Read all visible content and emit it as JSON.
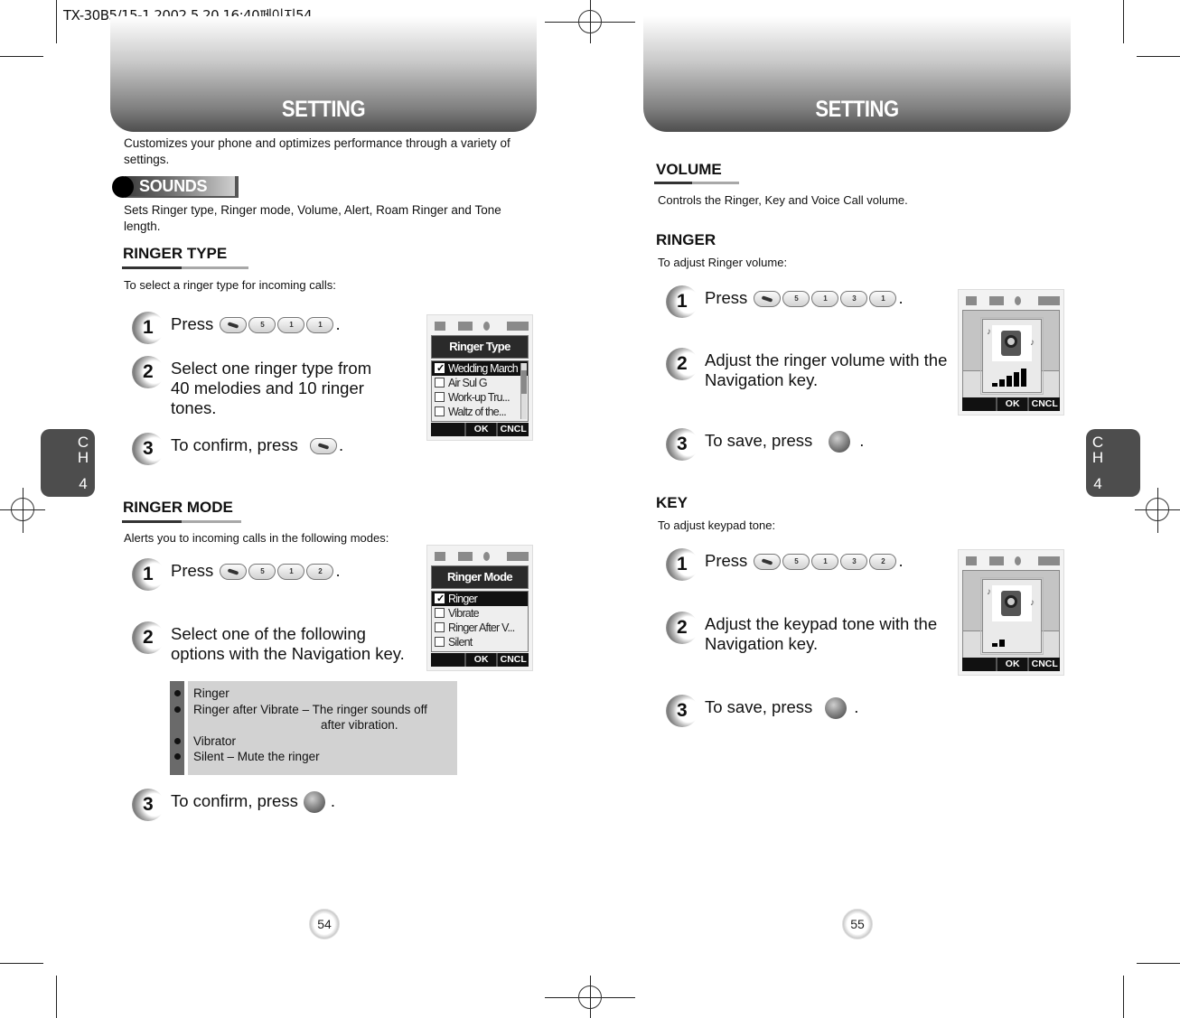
{
  "print_header": "TX-30B5/15-1  2002.5.20 16:40페이지54",
  "left_page": {
    "banner_title": "SETTING",
    "intro": "Customizes your phone and optimizes performance through a variety of settings.",
    "sounds_label": "SOUNDS",
    "sounds_desc": "Sets Ringer type, Ringer mode, Volume, Alert, Roam Ringer and Tone length.",
    "chapter_tab": {
      "letters": "CH",
      "number": "4"
    },
    "page_number": "54",
    "ringer_type": {
      "heading": "RINGER TYPE",
      "desc": "To select a ringer type for incoming calls:",
      "steps": [
        {
          "num": "1",
          "text": "Press",
          "keys": [
            "send",
            "5",
            "1",
            "1"
          ],
          "suffix": "."
        },
        {
          "num": "2",
          "text_lines": [
            "Select one ringer type from",
            "40 melodies and 10 ringer",
            "tones."
          ]
        },
        {
          "num": "3",
          "text": "To confirm, press",
          "keys": [
            "send"
          ],
          "suffix": "."
        }
      ],
      "screen": {
        "title": "Ringer Type",
        "items": [
          {
            "label": "Wedding March",
            "checked": true,
            "selected": true
          },
          {
            "label": "Air Sul G",
            "checked": false,
            "selected": false
          },
          {
            "label": "Work-up Tru...",
            "checked": false,
            "selected": false
          },
          {
            "label": "Waltz of the...",
            "checked": false,
            "selected": false
          }
        ],
        "softkeys": {
          "left": "",
          "ok": "OK",
          "cancel": "CNCL"
        }
      }
    },
    "ringer_mode": {
      "heading": "RINGER MODE",
      "desc": "Alerts you to incoming calls in the following modes:",
      "steps": [
        {
          "num": "1",
          "text": "Press",
          "keys": [
            "send",
            "5",
            "1",
            "2"
          ],
          "suffix": "."
        },
        {
          "num": "2",
          "text_lines": [
            "Select one of the following",
            "options with the Navigation key."
          ]
        },
        {
          "num": "3",
          "text": "To confirm, press",
          "button": "ok-center-key",
          "suffix": "."
        }
      ],
      "options": [
        {
          "line1": "Ringer"
        },
        {
          "line1": "Ringer after Vibrate – The ringer sounds off",
          "line2": "after vibration."
        },
        {
          "line1": "Vibrator"
        },
        {
          "line1": "Silent – Mute the ringer"
        }
      ],
      "screen": {
        "title": "Ringer Mode",
        "items": [
          {
            "label": "Ringer",
            "checked": true,
            "selected": true
          },
          {
            "label": "Vibrate",
            "checked": false,
            "selected": false
          },
          {
            "label": "Ringer After V...",
            "checked": false,
            "selected": false
          },
          {
            "label": "Silent",
            "checked": false,
            "selected": false
          }
        ],
        "softkeys": {
          "left": "",
          "ok": "OK",
          "cancel": "CNCL"
        }
      }
    }
  },
  "right_page": {
    "banner_title": "SETTING",
    "chapter_tab": {
      "letters": "CH",
      "number": "4"
    },
    "page_number": "55",
    "volume": {
      "heading": "VOLUME",
      "desc": "Controls the Ringer, Key and Voice Call volume."
    },
    "ringer": {
      "heading": "RINGER",
      "desc": "To adjust Ringer volume:",
      "steps": [
        {
          "num": "1",
          "text": "Press",
          "keys": [
            "send",
            "5",
            "1",
            "3",
            "1"
          ],
          "suffix": "."
        },
        {
          "num": "2",
          "text_lines": [
            "Adjust the ringer volume with the",
            "Navigation key."
          ]
        },
        {
          "num": "3",
          "text": "To save, press",
          "button": "ok-center-key",
          "suffix": "."
        }
      ],
      "screen": {
        "volume_level": 5,
        "volume_max": 5,
        "softkeys": {
          "left": "",
          "ok": "OK",
          "cancel": "CNCL"
        }
      }
    },
    "key": {
      "heading": "KEY",
      "desc": "To adjust keypad tone:",
      "steps": [
        {
          "num": "1",
          "text": "Press",
          "keys": [
            "send",
            "5",
            "1",
            "3",
            "2"
          ],
          "suffix": "."
        },
        {
          "num": "2",
          "text_lines": [
            "Adjust the keypad tone with the",
            "Navigation key."
          ]
        },
        {
          "num": "3",
          "text": "To save, press",
          "button": "ok-center-key",
          "suffix": "."
        }
      ],
      "screen": {
        "volume_level": 2,
        "volume_max": 5,
        "softkeys": {
          "left": "",
          "ok": "OK",
          "cancel": "CNCL"
        }
      }
    }
  },
  "key_labels": {
    "send": "",
    "1": "1",
    "2": "2",
    "3": "3",
    "5": "5"
  }
}
